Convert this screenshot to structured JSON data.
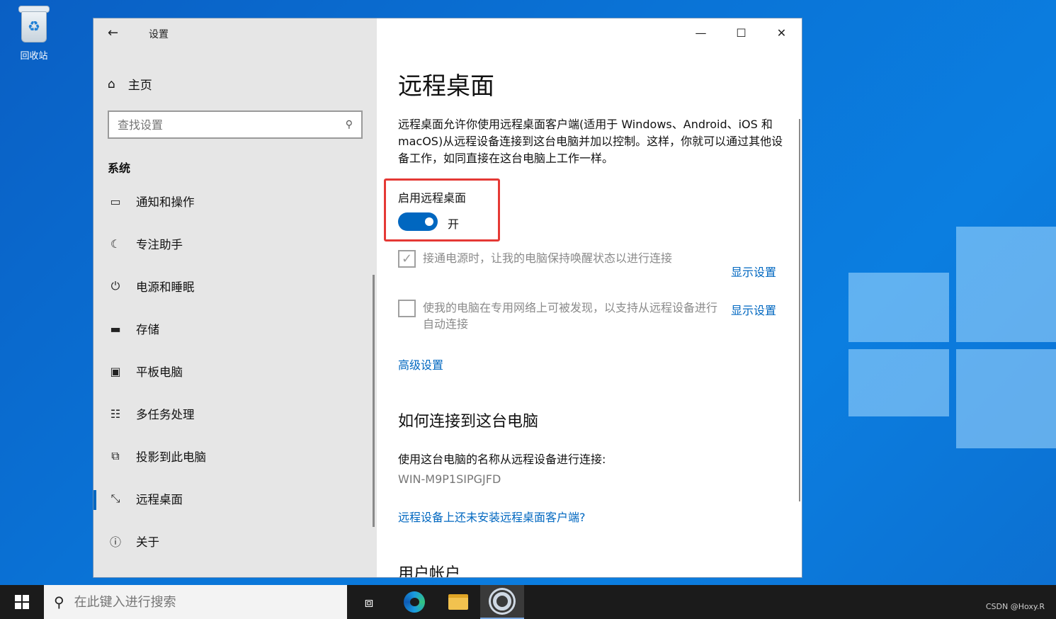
{
  "desktop": {
    "recycle_bin_label": "回收站"
  },
  "window": {
    "app_title": "设置",
    "home_label": "主页",
    "search_placeholder": "查找设置",
    "section": "系统",
    "nav_items": [
      {
        "label": "通知和操作",
        "icon": "notification-icon"
      },
      {
        "label": "专注助手",
        "icon": "moon-icon"
      },
      {
        "label": "电源和睡眠",
        "icon": "power-icon"
      },
      {
        "label": "存储",
        "icon": "storage-icon"
      },
      {
        "label": "平板电脑",
        "icon": "tablet-icon"
      },
      {
        "label": "多任务处理",
        "icon": "multitask-icon"
      },
      {
        "label": "投影到此电脑",
        "icon": "project-icon"
      },
      {
        "label": "远程桌面",
        "icon": "remote-desktop-icon",
        "selected": true
      },
      {
        "label": "关于",
        "icon": "info-icon"
      }
    ]
  },
  "content": {
    "title": "远程桌面",
    "description": "远程桌面允许你使用远程桌面客户端(适用于 Windows、Android、iOS 和 macOS)从远程设备连接到这台电脑并加以控制。这样，你就可以通过其他设备工作，如同直接在这台电脑上工作一样。",
    "toggle_label": "启用远程桌面",
    "toggle_state": "开",
    "toggle_on": true,
    "checkbox1_text": "接通电源时，让我的电脑保持唤醒状态以进行连接",
    "checkbox1_checked": true,
    "checkbox2_text": "使我的电脑在专用网络上可被发现，以支持从远程设备进行自动连接",
    "checkbox2_checked": false,
    "show_settings_1": "显示设置",
    "show_settings_2": "显示设置",
    "advanced_link": "高级设置",
    "how_to_heading": "如何连接到这台电脑",
    "how_to_text": "使用这台电脑的名称从远程设备进行连接:",
    "pc_name": "WIN-M9P1SIPGJFD",
    "client_link": "远程设备上还未安装远程桌面客户端?",
    "accounts_heading": "用户帐户"
  },
  "taskbar": {
    "search_placeholder": "在此键入进行搜索",
    "watermark": "CSDN @Hoxy.R"
  },
  "colors": {
    "accent": "#0067c0",
    "highlight": "#e53935"
  }
}
